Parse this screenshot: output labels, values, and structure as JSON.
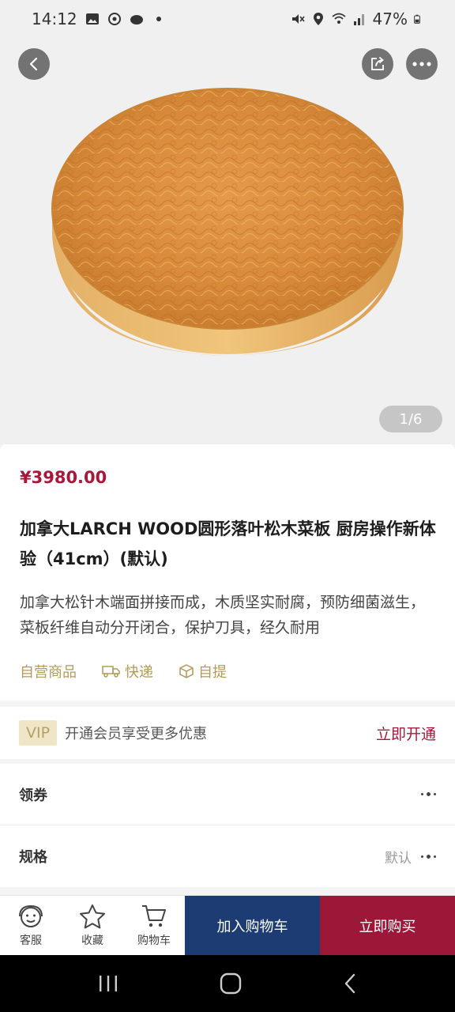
{
  "status_bar": {
    "time": "14:12",
    "battery": "47%"
  },
  "hero": {
    "pager": "1/6",
    "icons": [
      "back-icon",
      "share-icon",
      "more-icon"
    ]
  },
  "product": {
    "price": "¥3980.00",
    "title": "加拿大LARCH WOOD圆形落叶松木菜板 厨房操作新体验（41cm）(默认)",
    "description": "加拿大松针木端面拼接而成，木质坚实耐腐，预防细菌滋生，菜板纤维自动分开闭合，保护刀具，经久耐用",
    "tags": [
      "自营商品",
      "快递",
      "自提"
    ]
  },
  "vip": {
    "badge": "VIP",
    "text": "开通会员享受更多优惠",
    "action": "立即开通"
  },
  "options": {
    "coupon_label": "领券",
    "spec_label": "规格",
    "spec_value": "默认"
  },
  "action_bar": {
    "service": "客服",
    "favorite": "收藏",
    "cart": "购物车",
    "add_to_cart": "加入购物车",
    "buy_now": "立即购买"
  },
  "colors": {
    "price_red": "#a8183a",
    "cart_blue": "#1c3c73",
    "buy_red": "#9d1738",
    "tag_gold": "#b29a57"
  }
}
